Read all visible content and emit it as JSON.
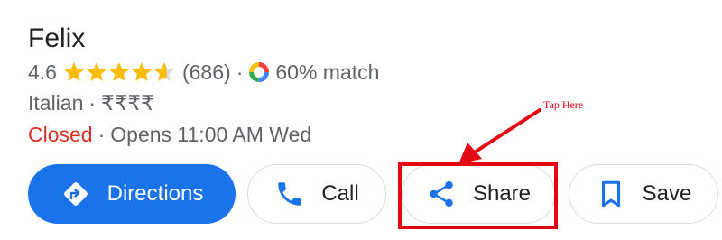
{
  "place": {
    "name": "Felix",
    "rating": "4.6",
    "stars_value": 4.6,
    "stars_max": 5,
    "reviews": "(686)",
    "separator": "·",
    "match": "60% match",
    "cuisine": "Italian",
    "price": "₹₹₹₹",
    "status": "Closed",
    "hours": "Opens 11:00 AM Wed"
  },
  "actions": {
    "directions_label": "Directions",
    "call_label": "Call",
    "share_label": "Share",
    "save_label": "Save"
  },
  "annotation": {
    "text": "Tap Here"
  },
  "colors": {
    "primary": "#1a73e8",
    "star": "#fbbc04",
    "closed": "#d93025",
    "highlight": "#e30613",
    "text": "#202124",
    "secondary_text": "#5f6368"
  },
  "icons": {
    "directions": "directions-icon",
    "call": "phone-icon",
    "share": "share-icon",
    "save": "bookmark-icon",
    "match": "google-match-icon",
    "star": "star-icon"
  }
}
